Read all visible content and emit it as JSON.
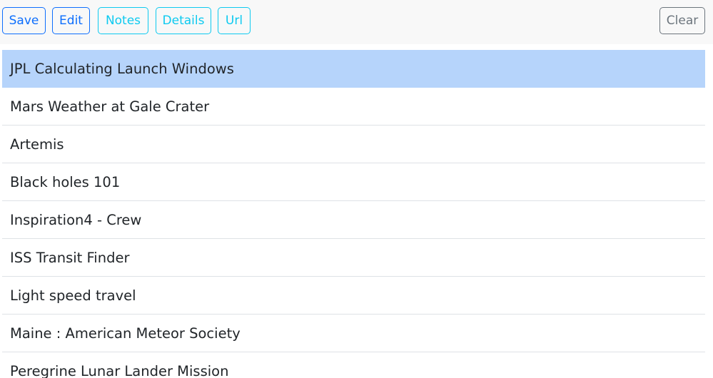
{
  "toolbar": {
    "save_label": "Save",
    "edit_label": "Edit",
    "notes_label": "Notes",
    "details_label": "Details",
    "url_label": "Url",
    "clear_label": "Clear"
  },
  "list": {
    "selected_index": 0,
    "items": [
      "JPL Calculating Launch Windows",
      "Mars Weather at Gale Crater",
      "Artemis",
      "Black holes 101",
      "Inspiration4 - Crew",
      "ISS Transit Finder",
      "Light speed travel",
      "Maine : American Meteor Society",
      "Peregrine Lunar Lander Mission"
    ]
  },
  "colors": {
    "primary": "#0d6efd",
    "info": "#0dcaf0",
    "secondary": "#6c757d",
    "selected_row": "#b6d4fb"
  }
}
